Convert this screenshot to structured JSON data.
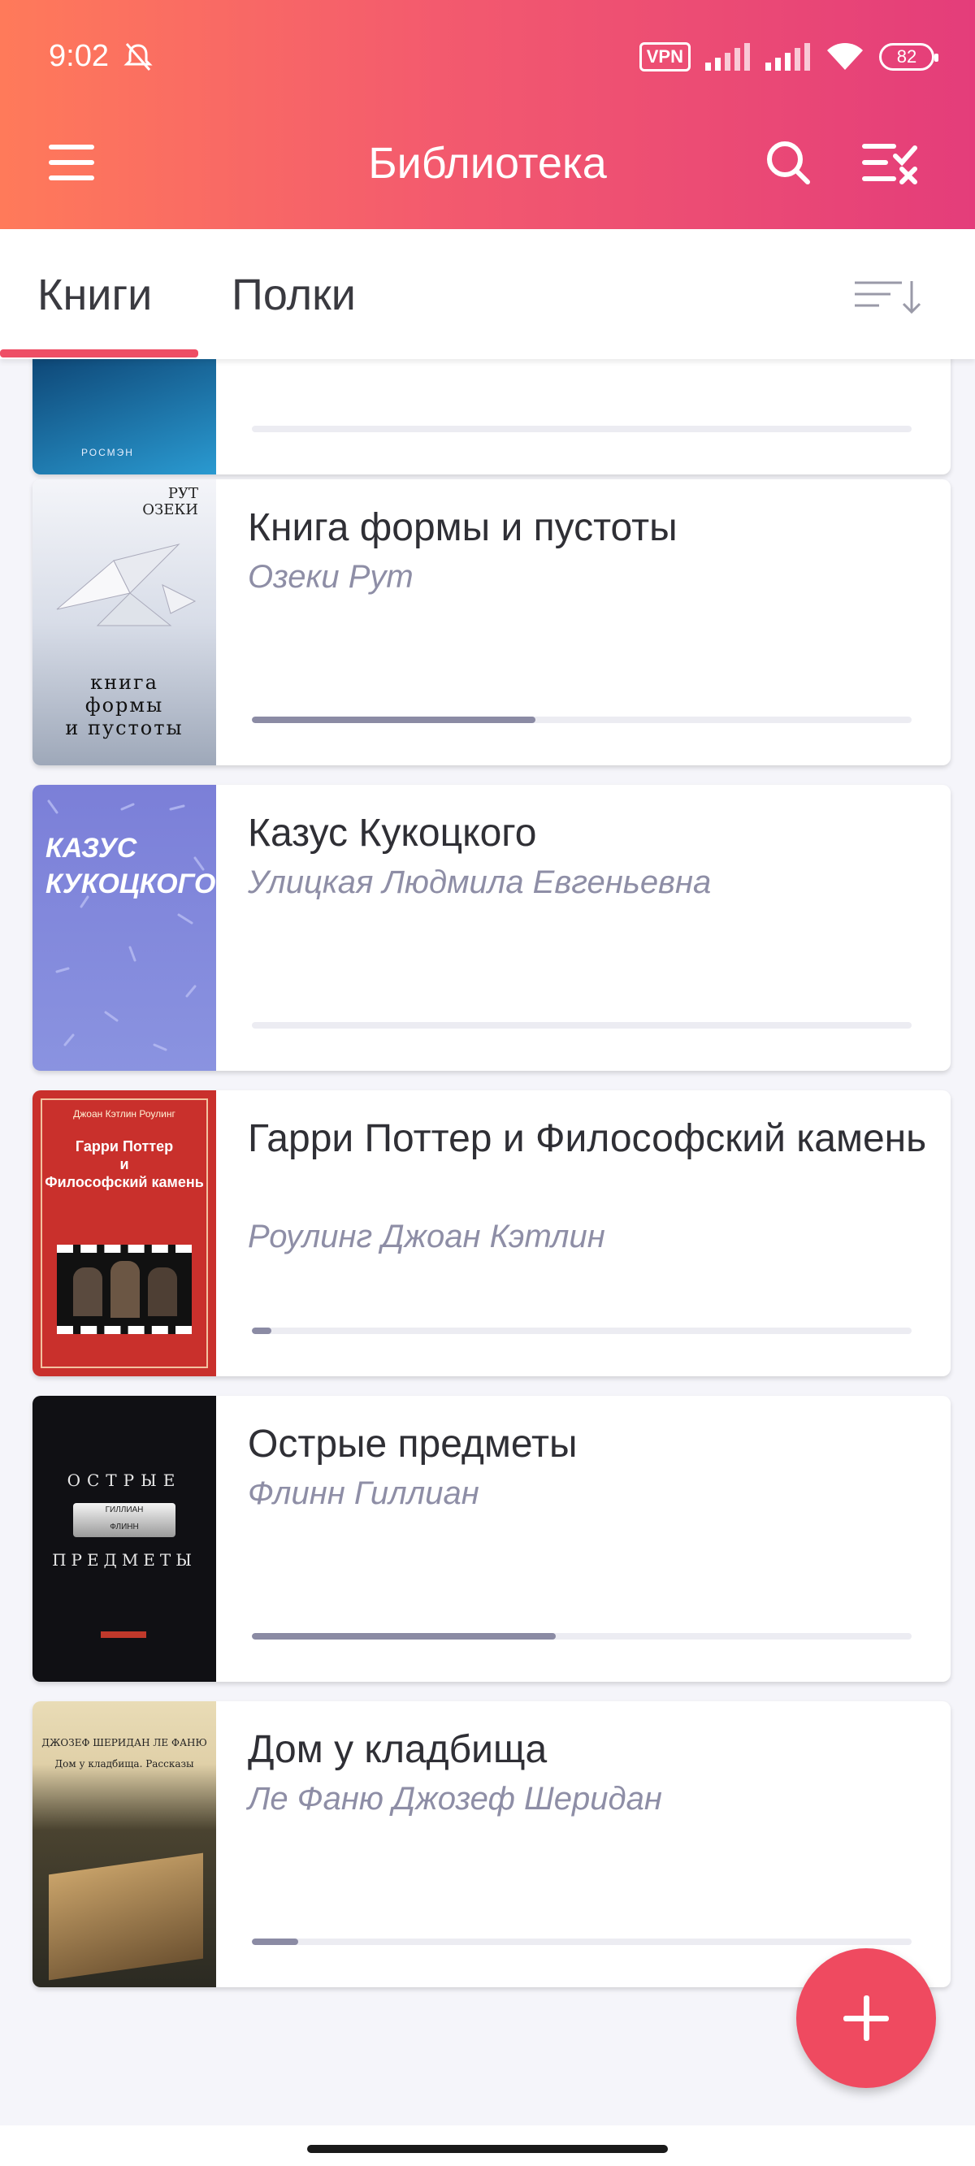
{
  "status_bar": {
    "time": "9:02",
    "vpn": "VPN",
    "battery": "82"
  },
  "app_bar": {
    "title": "Библиотека"
  },
  "tabs": [
    {
      "label": "Книги",
      "selected": true
    },
    {
      "label": "Полки",
      "selected": false
    }
  ],
  "books": [
    {
      "title": "",
      "author": "",
      "progress": 0.0,
      "cover_text": [
        "РОСМЭН"
      ]
    },
    {
      "title": "Книга формы и пустоты",
      "author": "Озеки Рут",
      "progress": 0.43,
      "cover_text": [
        "РУТ",
        "ОЗЕКИ",
        "книга",
        "формы",
        "и пустоты"
      ]
    },
    {
      "title": "Казус Кукоцкого",
      "author": "Улицкая Людмила Евгеньевна",
      "progress": 0.0,
      "cover_text": [
        "КАЗУС",
        "КУКОЦКОГО"
      ]
    },
    {
      "title": "Гарри Поттер и Философский камень",
      "author": "Роулинг Джоан Кэтлин",
      "progress": 0.03,
      "cover_text": [
        "Джоан Кэтлин Роулинг",
        "Гарри Поттер",
        "и",
        "Философский камень"
      ]
    },
    {
      "title": "Острые предметы",
      "author": "Флинн Гиллиан",
      "progress": 0.46,
      "cover_text": [
        "ОСТРЫЕ",
        "ГИЛЛИАН",
        "ФЛИНН",
        "ПРЕДМЕТЫ"
      ]
    },
    {
      "title": "Дом у кладбища",
      "author": "Ле Фаню Джозеф Шеридан",
      "progress": 0.07,
      "cover_text": [
        "ДЖОЗЕФ ШЕРИДАН ЛЕ ФАНЮ",
        "Дом у кладбища. Рассказы"
      ]
    }
  ],
  "colors": {
    "accent": "#ee4e65",
    "appbar_gradient_start": "#ff7a5a",
    "appbar_gradient_end": "#e43d7a",
    "author_text": "#8e8ea6",
    "progress_fill": "#8b8ba4"
  },
  "icons": {
    "menu": "hamburger-icon",
    "search": "search-icon",
    "select": "checklist-icon",
    "sort": "sort-icon",
    "fab": "plus-icon"
  }
}
